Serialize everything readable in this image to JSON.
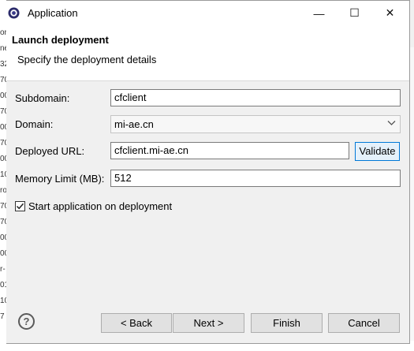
{
  "background": {
    "edge_chars": [
      "or",
      "ne",
      "32",
      "70",
      "00",
      "70",
      "00",
      "70",
      "00",
      "10",
      "ro",
      "70",
      "70",
      "00",
      "00",
      "r-",
      "01",
      "10",
      "7"
    ]
  },
  "window": {
    "title": "Application",
    "minimize_glyph": "—",
    "maximize_glyph": "☐",
    "close_glyph": "✕"
  },
  "header": {
    "title": "Launch deployment",
    "description": "Specify the deployment details"
  },
  "form": {
    "subdomain": {
      "label": "Subdomain:",
      "value": "cfclient"
    },
    "domain": {
      "label": "Domain:",
      "selected": "mi-ae.cn"
    },
    "deployed_url": {
      "label": "Deployed URL:",
      "value": "cfclient.mi-ae.cn",
      "validate_label": "Validate"
    },
    "memory_limit": {
      "label": "Memory Limit (MB):",
      "value": "512"
    },
    "start_on_deploy": {
      "label": "Start application on deployment",
      "checked": true
    }
  },
  "buttons": {
    "help": "?",
    "back": "< Back",
    "next": "Next >",
    "finish": "Finish",
    "cancel": "Cancel"
  },
  "colors": {
    "accent": "#0078d7",
    "dialog_bg": "#f0f0f0",
    "header_bg": "#ffffff"
  }
}
